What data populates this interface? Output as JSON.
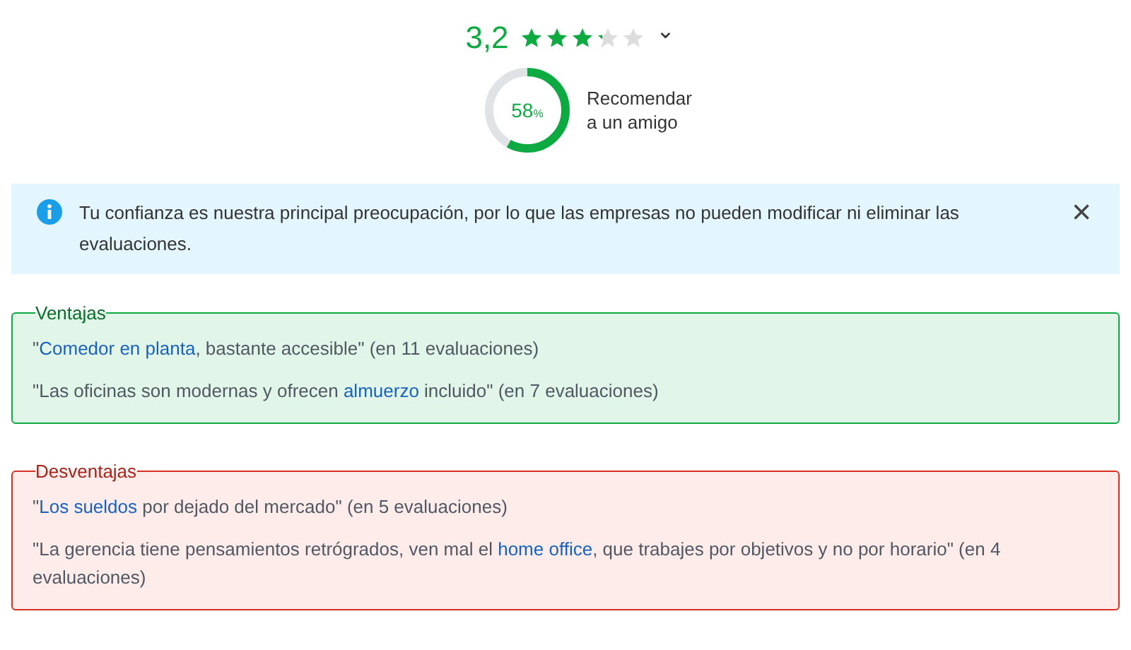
{
  "rating": {
    "value": "3,2",
    "stars": 3.2,
    "caret": "⌄"
  },
  "recommend": {
    "level": 0.58,
    "percent": "58",
    "unit": "%",
    "label": "Recomendar a un amigo"
  },
  "notice": {
    "text": "Tu confianza es nuestra principal preocupación, por lo que las empresas no pueden modificar ni eliminar las evaluaciones.",
    "close": "×"
  },
  "sections": [
    {
      "kind": "pros",
      "title": "Ventajas",
      "items": [
        [
          {
            "kind": "text",
            "text": "\""
          },
          {
            "kind": "link",
            "text": "Comedor en planta"
          },
          {
            "kind": "text",
            "text": ", bastante accesible\" (en 11 evaluaciones)"
          }
        ],
        [
          {
            "kind": "text",
            "text": "\"Las oficinas son modernas y ofrecen "
          },
          {
            "kind": "link",
            "text": "almuerzo"
          },
          {
            "kind": "text",
            "text": " incluido\" (en 7 evaluaciones)"
          }
        ]
      ]
    },
    {
      "kind": "cons",
      "title": "Desventajas",
      "items": [
        [
          {
            "kind": "text",
            "text": "\""
          },
          {
            "kind": "link",
            "text": "Los sueldos"
          },
          {
            "kind": "text",
            "text": " por dejado del mercado\" (en 5 evaluaciones)"
          }
        ],
        [
          {
            "kind": "text",
            "text": "\"La gerencia tiene pensamientos retrógrados, ven mal el "
          },
          {
            "kind": "link",
            "text": "home office"
          },
          {
            "kind": "text",
            "text": ", que trabajes por objetivos y no por horario\" (en 4 evaluaciones)"
          }
        ]
      ]
    }
  ]
}
